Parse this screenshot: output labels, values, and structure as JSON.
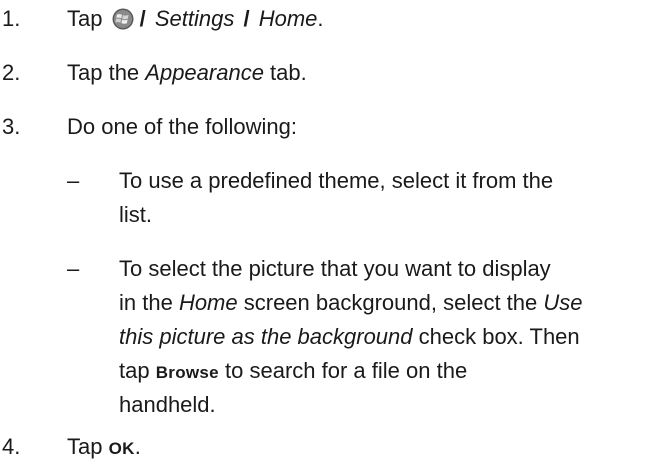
{
  "steps": [
    {
      "number": "1.",
      "prefix": "Tap",
      "icon": "windows-start-icon",
      "separator": "/",
      "settings": "Settings",
      "home": "Home",
      "suffix": "."
    },
    {
      "number": "2.",
      "prefix": "Tap the ",
      "italic": "Appearance",
      "suffix": " tab."
    },
    {
      "number": "3.",
      "text": "Do one of the following:"
    },
    {
      "number": "4.",
      "prefix": "Tap ",
      "button": "OK",
      "suffix": "."
    }
  ],
  "subitems": [
    {
      "bullet": "–",
      "line1": "To use a predefined theme, select it from the",
      "line2": "list."
    },
    {
      "bullet": "–",
      "line1": "To select the picture that you want to display",
      "line2_a": "in the ",
      "line2_b": "Home",
      "line2_c": " screen background, select the ",
      "line2_d": "Use",
      "line3_a": "this picture as the background",
      "line3_b": " check box. Then",
      "line4_a": "tap ",
      "line4_b": "Browse",
      "line4_c": " to search for a file on the",
      "line5": "handheld."
    }
  ]
}
